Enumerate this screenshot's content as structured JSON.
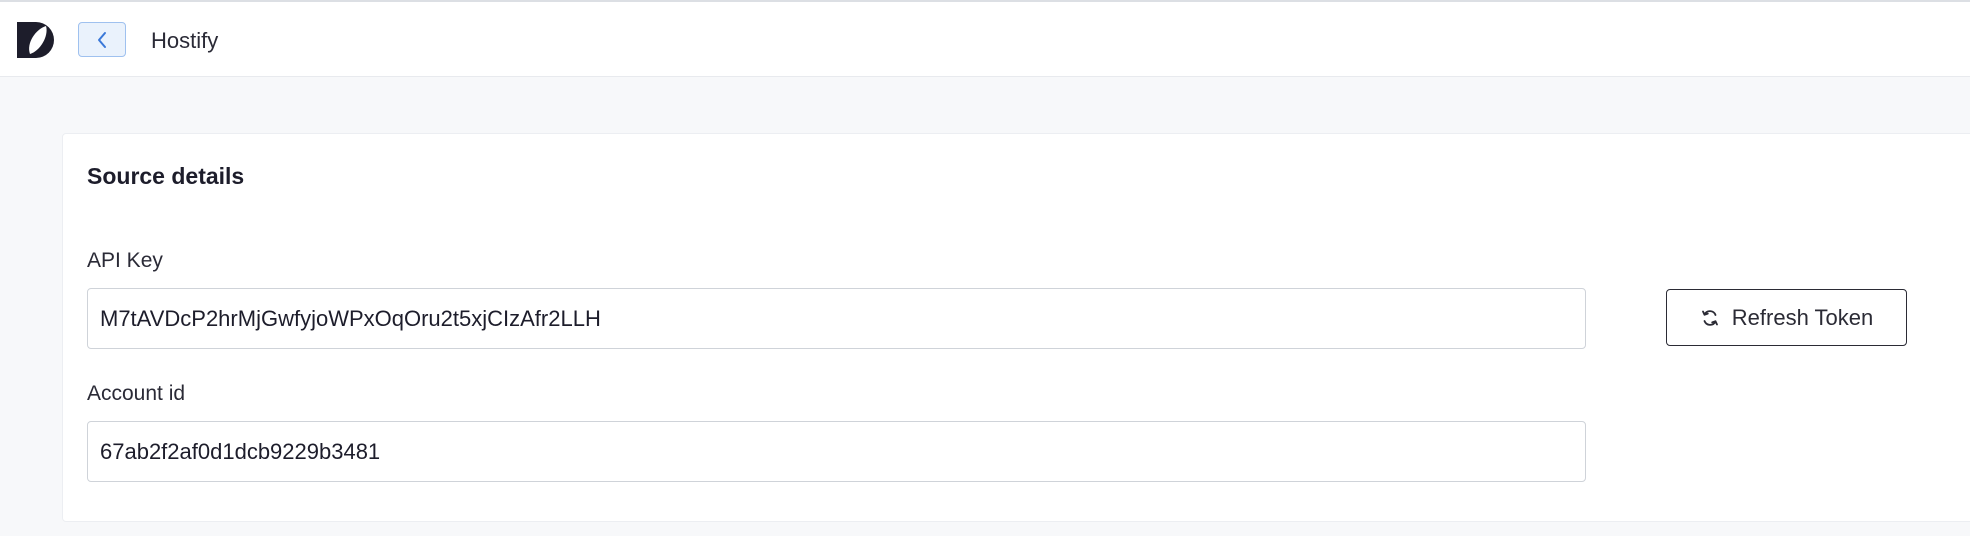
{
  "header": {
    "logo_icon": "brand-logo-icon",
    "back_icon": "chevron-left-icon",
    "title": "Hostify"
  },
  "card": {
    "title": "Source details",
    "api_key": {
      "label": "API Key",
      "value": "M7tAVDcP2hrMjGwfyjoWPxOqOru2t5xjCIzAfr2LLH"
    },
    "account_id": {
      "label": "Account id",
      "value": "67ab2f2af0d1dcb9229b3481"
    },
    "refresh_button": {
      "icon": "refresh-icon",
      "label": "Refresh Token"
    }
  },
  "colors": {
    "background": "#f7f8fa",
    "accent_blue": "#3a78d8",
    "text_dark": "#1d1d2b",
    "border": "#cfd3d9"
  }
}
